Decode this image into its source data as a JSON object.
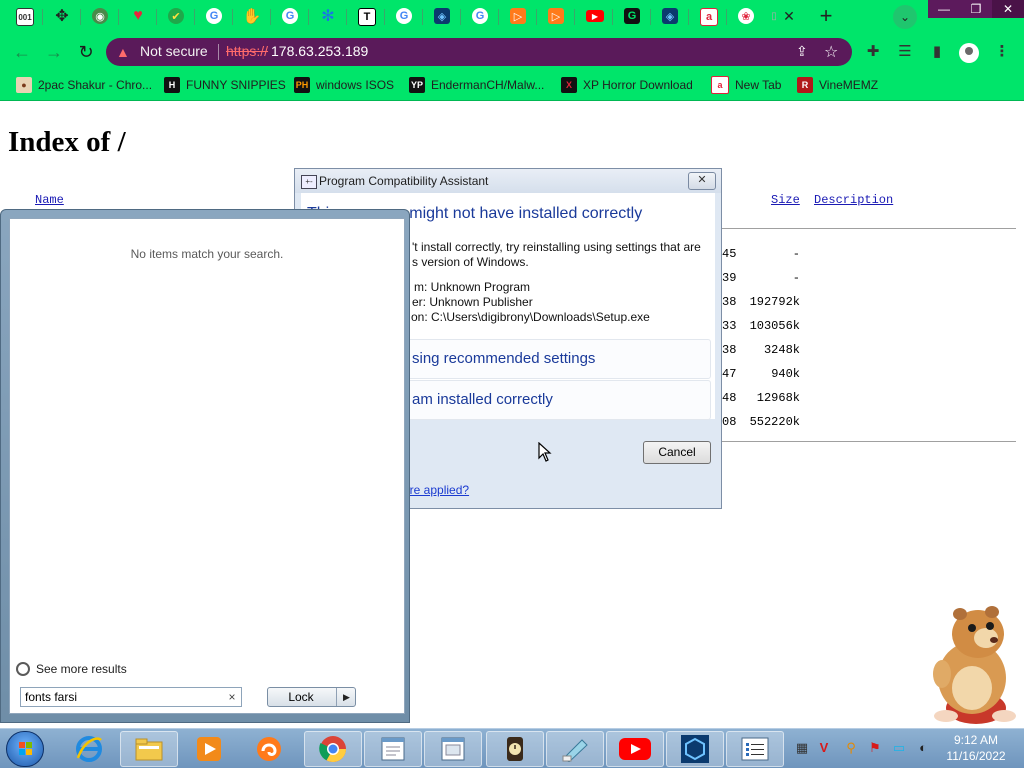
{
  "browser": {
    "tabs": [
      {
        "icon": "tab-1-favicon"
      },
      {
        "icon": "tab-2-favicon"
      },
      {
        "icon": "tab-3-favicon"
      },
      {
        "icon": "tab-4-favicon"
      },
      {
        "icon": "tab-5-favicon"
      },
      {
        "icon": "tab-6-favicon"
      },
      {
        "icon": "tab-7-favicon"
      },
      {
        "icon": "tab-8-favicon"
      },
      {
        "icon": "tab-9-favicon"
      },
      {
        "icon": "tab-10-favicon"
      },
      {
        "icon": "tab-11-favicon"
      },
      {
        "icon": "tab-12-favicon"
      },
      {
        "icon": "tab-13-favicon"
      },
      {
        "icon": "tab-14-favicon"
      },
      {
        "icon": "tab-15-favicon"
      },
      {
        "icon": "tab-16-favicon"
      },
      {
        "icon": "tab-17-favicon"
      },
      {
        "icon": "tab-18-favicon"
      },
      {
        "icon": "tab-19-favicon"
      },
      {
        "icon": "tab-20-favicon"
      },
      {
        "icon": "tab-21-favicon"
      }
    ],
    "active_tab_close": "✕",
    "new_tab": "+",
    "security_label": "Not secure",
    "url_scheme": "https://",
    "url_host": "178.63.253.189",
    "bookmarks": [
      {
        "label": "2pac Shakur - Chro..."
      },
      {
        "label": "FUNNY SNIPPIES"
      },
      {
        "label": "windows ISOS"
      },
      {
        "label": "EndermanCH/Malw..."
      },
      {
        "label": "XP Horror Download"
      },
      {
        "label": "New Tab"
      },
      {
        "label": "VineMEMZ"
      }
    ],
    "colors": {
      "chrome": "#00e56a",
      "omnibox": "#5a1a5a",
      "window_controls": "#5c1a5c"
    }
  },
  "listing": {
    "title": "Index of /",
    "columns": {
      "name": "Name",
      "size": "Size",
      "description": "Description"
    },
    "rows": [
      {
        "date_tail": "45",
        "size": "-"
      },
      {
        "date_tail": "39",
        "size": "-"
      },
      {
        "date_tail": "38",
        "size": "192792k"
      },
      {
        "date_tail": "33",
        "size": "103056k"
      },
      {
        "date_tail": "38",
        "size": "3248k"
      },
      {
        "date_tail": "47",
        "size": "940k"
      },
      {
        "date_tail": "48",
        "size": "12968k"
      },
      {
        "date_tail": "08",
        "size": "552220k"
      }
    ]
  },
  "dialog": {
    "title": "Program Compatibility Assistant",
    "close": "✕",
    "heading_start": "This",
    "heading_end": "might not have installed correctly",
    "message_line1": "'t install correctly, try reinstalling using settings that are",
    "message_line2": "s version of Windows.",
    "program_line": "m: Unknown Program",
    "publisher_line": "er: Unknown Publisher",
    "location_line": "on: C:\\Users\\digibrony\\Downloads\\Setup.exe",
    "option_reinstall": "sing recommended settings",
    "option_ok": "am installed correctly",
    "cancel": "Cancel",
    "link": "are applied?"
  },
  "start_menu": {
    "no_items": "No items match your search.",
    "see_more": "See more results",
    "search_value": "fonts farsi",
    "clear": "×",
    "lock_label": "Lock",
    "lock_arrow": "▶"
  },
  "taskbar": {
    "pinned": [
      "internet-explorer-icon",
      "file-explorer-icon",
      "media-player-icon",
      "uc-browser-icon",
      "chrome-icon",
      "notepad-window-icon",
      "document-window-icon",
      "clock-app-icon",
      "paint-icon",
      "youtube-icon",
      "box-app-icon",
      "list-app-icon"
    ],
    "clock_time": "9:12 AM",
    "clock_date": "11/16/2022"
  }
}
